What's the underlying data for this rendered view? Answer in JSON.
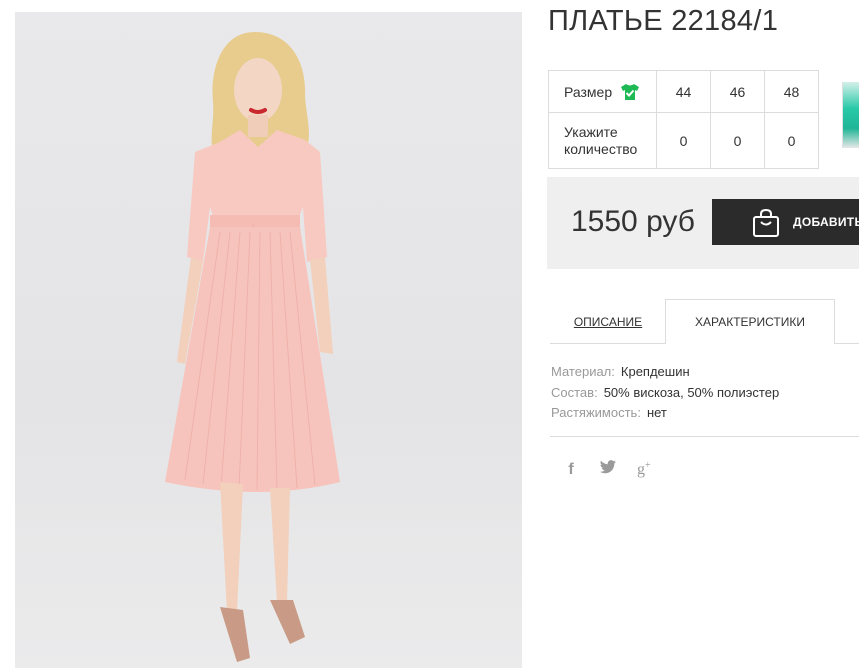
{
  "product": {
    "title": "ПЛАТЬЕ 22184/1",
    "image_alt": "Woman in pink pleated midi dress with tie belt and nude heels"
  },
  "sizes": {
    "size_label": "Размер",
    "size_icon": "shirt-check-icon",
    "values": [
      "44",
      "46",
      "48"
    ],
    "qty_label": "Укажите количество",
    "qty_values": [
      "0",
      "0",
      "0"
    ]
  },
  "price": {
    "amount": "1550 руб",
    "add_button": "ДОБАВИТЬ"
  },
  "tabs": {
    "description": "ОПИСАНИЕ",
    "characteristics": "ХАРАКТЕРИСТИКИ"
  },
  "properties": [
    {
      "key": "Материал:",
      "value": "Крепдешин"
    },
    {
      "key": "Состав:",
      "value": "50% вискоза, 50% полиэстер"
    },
    {
      "key": "Растяжимость:",
      "value": "нет"
    }
  ],
  "social": {
    "facebook": "f",
    "google": "g",
    "google_plus": "+"
  },
  "colors": {
    "button_bg": "#2b2b2b",
    "price_bg": "#efefef",
    "icon_green": "#1db954",
    "dress": "#f7c4bd"
  }
}
